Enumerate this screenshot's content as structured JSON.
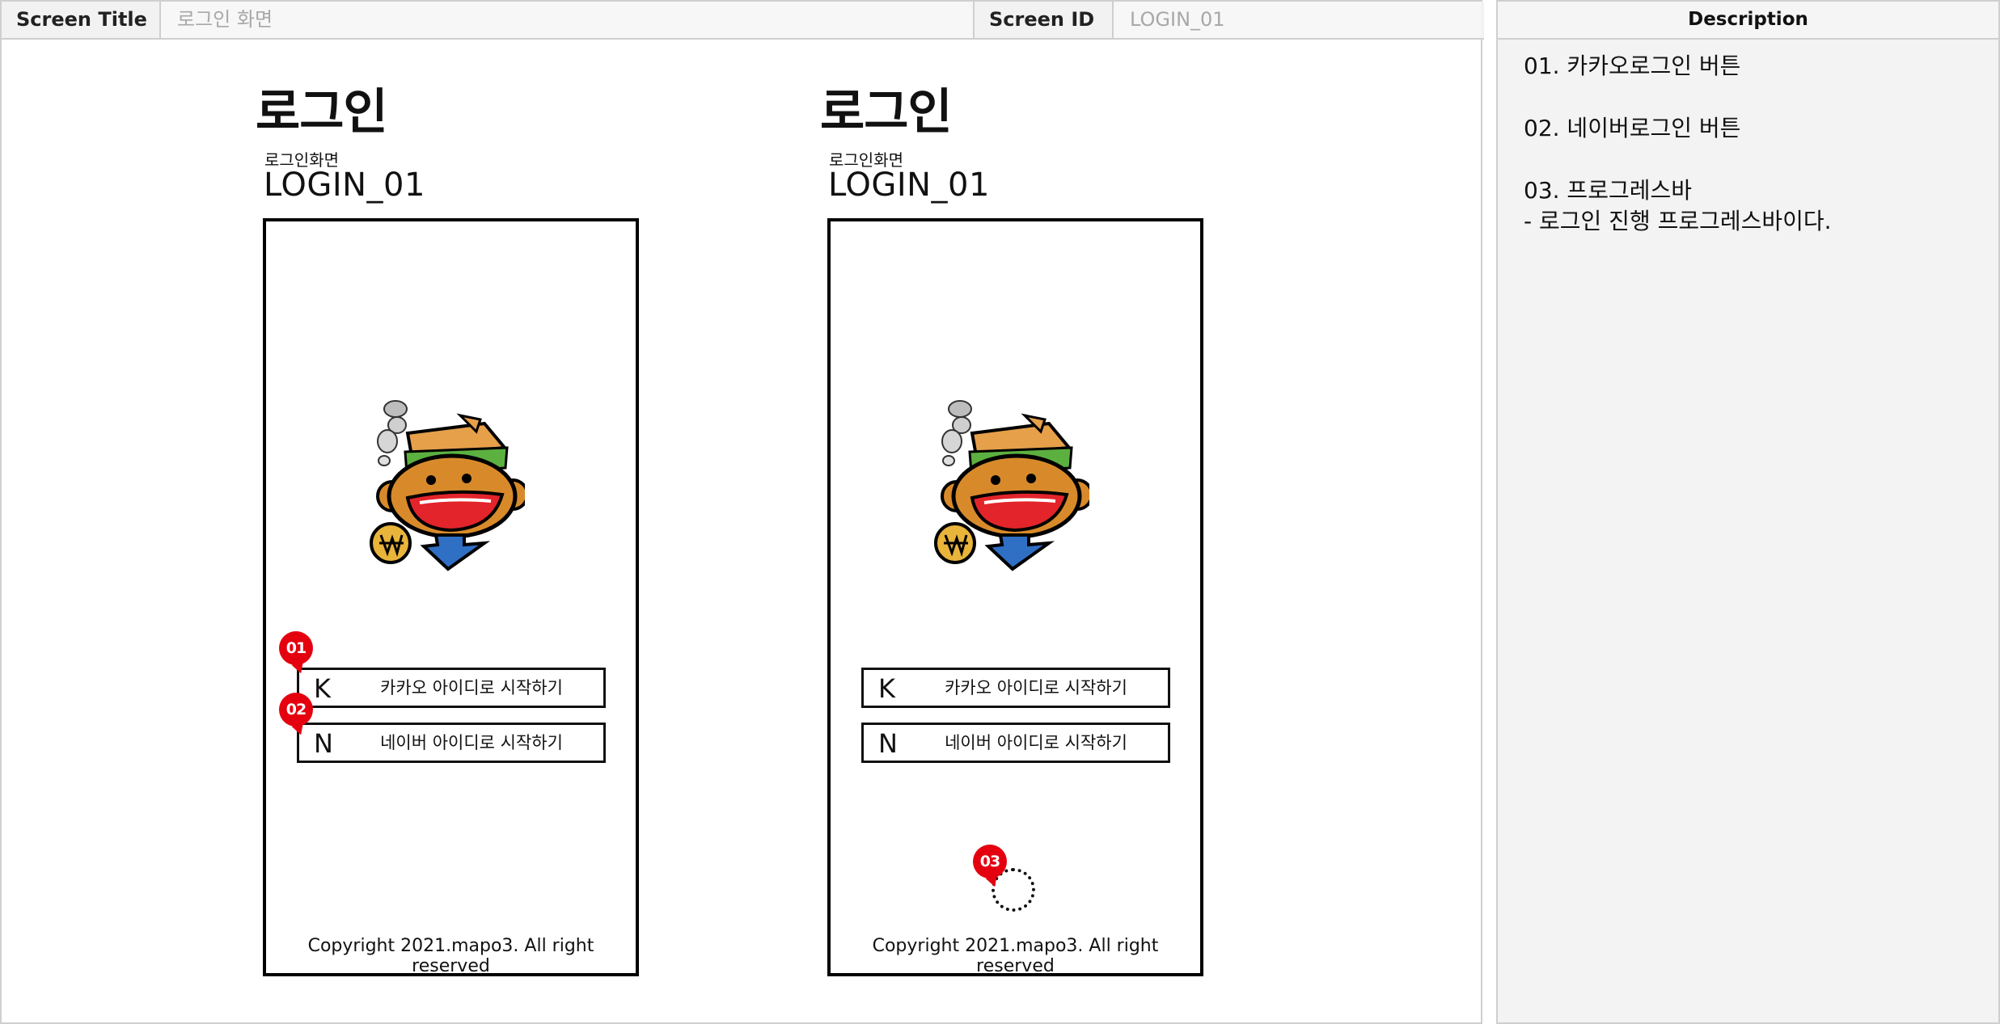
{
  "header": {
    "screen_title_label": "Screen Title",
    "screen_title_value": "로그인 화면",
    "screen_id_label": "Screen ID",
    "screen_id_value": "LOGIN_01"
  },
  "description": {
    "title": "Description",
    "items": [
      {
        "line1": "01. 카카오로그인 버튼",
        "line2": ""
      },
      {
        "line1": "02. 네이버로그인 버튼",
        "line2": ""
      },
      {
        "line1": "03. 프로그레스바",
        "line2": "- 로그인 진행 프로그레스바이다."
      }
    ]
  },
  "screens": [
    {
      "heading": "로그인",
      "subheading": "로그인화면",
      "screen_id": "LOGIN_01",
      "kakao_letter": "K",
      "kakao_label": "카카오 아이디로 시작하기",
      "naver_letter": "N",
      "naver_label": "네이버 아이디로 시작하기",
      "copyright": "Copyright 2021.mapo3. All right reserved",
      "badges": [
        "01",
        "02"
      ]
    },
    {
      "heading": "로그인",
      "subheading": "로그인화면",
      "screen_id": "LOGIN_01",
      "kakao_letter": "K",
      "kakao_label": "카카오 아이디로 시작하기",
      "naver_letter": "N",
      "naver_label": "네이버 아이디로 시작하기",
      "copyright": "Copyright 2021.mapo3. All right reserved",
      "badges": [
        "03"
      ]
    }
  ],
  "icons": {
    "mascot": "mascot-icon",
    "progress": "spinner-icon"
  },
  "colors": {
    "badge": "#e4000f",
    "mascot_hat": "#e6a04a",
    "mascot_face": "#d88a2a",
    "mascot_mouth": "#e3242b",
    "mascot_band": "#5cb040",
    "mascot_arrow": "#2f6fc4",
    "mascot_coin": "#e8b43a"
  }
}
